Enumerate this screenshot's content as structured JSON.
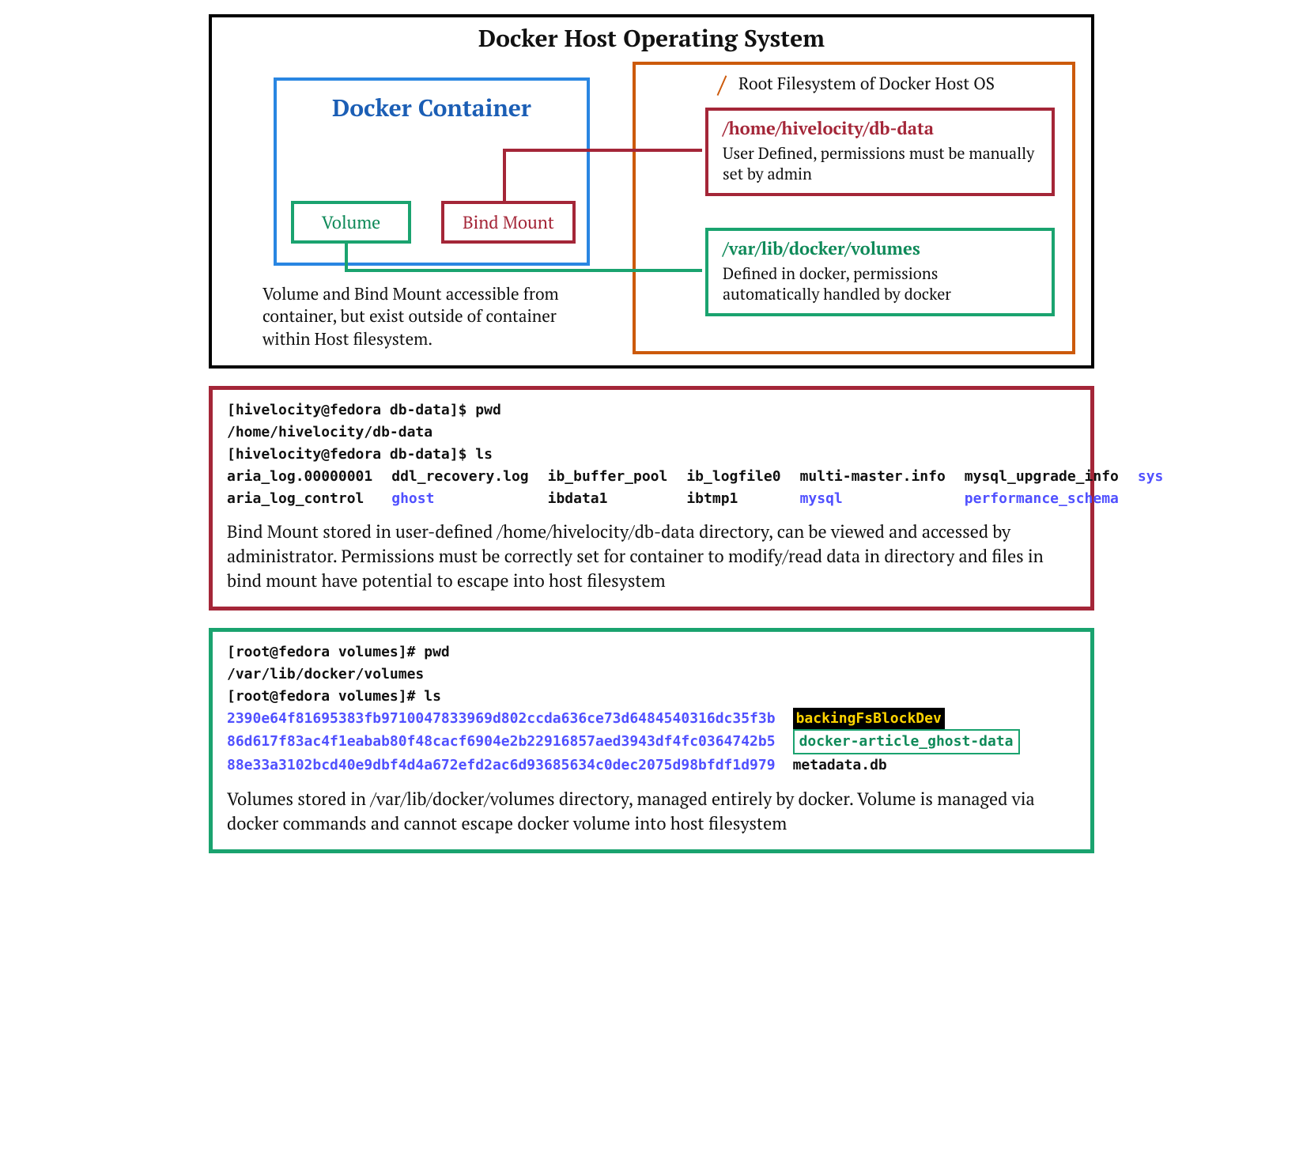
{
  "diagram": {
    "host_title": "Docker Host Operating System",
    "container_title": "Docker Container",
    "volume_label": "Volume",
    "bindmount_label": "Bind Mount",
    "container_note": "Volume and Bind Mount accessible from container, but exist outside of container within Host filesystem.",
    "rootfs_slash": "/",
    "rootfs_label": "Root Filesystem of Docker Host OS",
    "bind_target_path": "/home/hivelocity/db-data",
    "bind_target_desc": "User Defined, permissions must be manually set by admin",
    "vol_target_path": "/var/lib/docker/volumes",
    "vol_target_desc": "Defined in docker, permissions automatically handled by docker"
  },
  "bind_panel": {
    "prompt1": "[hivelocity@fedora db-data]$ ",
    "cmd1": "pwd",
    "out1": "/home/hivelocity/db-data",
    "prompt2": "[hivelocity@fedora db-data]$ ",
    "cmd2": "ls",
    "ls_cols": [
      [
        "aria_log.00000001",
        "aria_log_control"
      ],
      [
        "ddl_recovery.log",
        "ghost"
      ],
      [
        "ib_buffer_pool",
        "ibdata1"
      ],
      [
        "ib_logfile0",
        "ibtmp1"
      ],
      [
        "multi-master.info",
        "mysql"
      ],
      [
        "mysql_upgrade_info",
        "performance_schema"
      ],
      [
        "sys",
        ""
      ]
    ],
    "ls_link_names": [
      "ghost",
      "mysql",
      "performance_schema",
      "sys"
    ],
    "desc": "Bind Mount stored in user-defined /home/hivelocity/db-data directory, can be viewed and accessed by administrator.  Permissions must be correctly set for container to modify/read data in directory and files in bind mount have potential to escape into host filesystem"
  },
  "vol_panel": {
    "prompt1": "[root@fedora volumes]# ",
    "cmd1": "pwd",
    "out1": "/var/lib/docker/volumes",
    "prompt2": "[root@fedora volumes]# ",
    "cmd2": "ls",
    "hashes": [
      "2390e64f81695383fb9710047833969d802ccda636ce73d6484540316dc35f3b",
      "86d617f83ac4f1eabab80f48cacf6904e2b22916857aed3943df4fc0364742b5",
      "88e33a3102bcd40e9dbf4d4a672efd2ac6d93685634c0dec2075d98bfdf1d979"
    ],
    "right_items": [
      "backingFsBlockDev",
      "docker-article_ghost-data",
      "metadata.db"
    ],
    "desc": "Volumes stored in /var/lib/docker/volumes directory, managed entirely by docker.  Volume is managed via docker commands and cannot escape docker volume into host filesystem"
  }
}
